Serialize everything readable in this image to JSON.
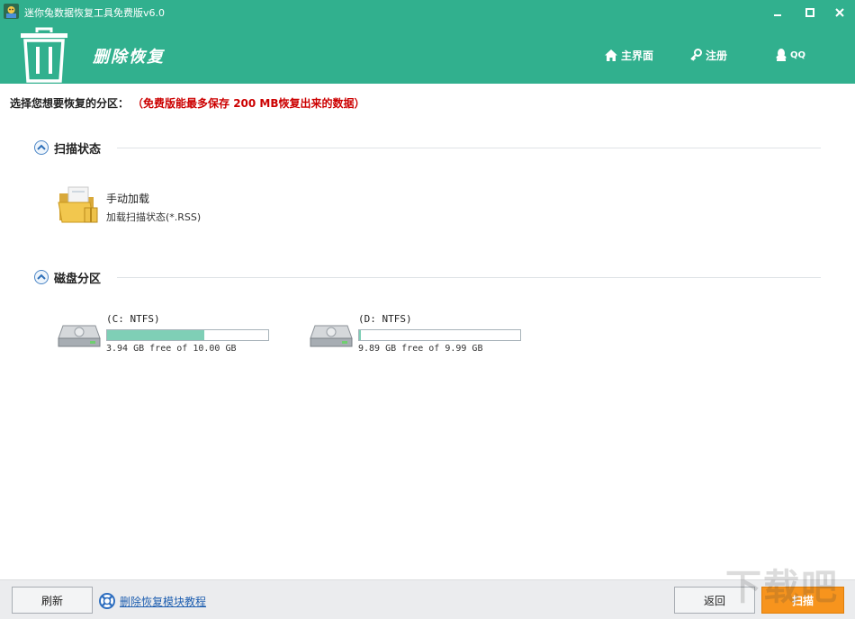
{
  "window": {
    "title": "迷你兔数据恢复工具免费版v6.0",
    "controls": [
      "minimize-icon",
      "maximize-icon",
      "close-icon"
    ]
  },
  "header": {
    "module_title": "删除恢复",
    "nav": {
      "home": "主界面",
      "register": "注册",
      "qq": "QQ"
    },
    "background_color": "#31b08e"
  },
  "prompt": {
    "label": "选择您想要恢复的分区：",
    "note": "（免费版能最多保存 200 MB恢复出来的数据）",
    "note_color": "#cc0000"
  },
  "scan_status": {
    "title": "扫描状态",
    "load": {
      "title": "手动加载",
      "subtitle": "加载扫描状态(*.RSS)"
    }
  },
  "partitions": {
    "title": "磁盘分区",
    "drives": [
      {
        "name": "(C: NTFS)",
        "free_text": "3.94 GB free of 10.00 GB",
        "used_fraction": 0.606
      },
      {
        "name": "(D: NTFS)",
        "free_text": "9.89 GB free of 9.99 GB",
        "used_fraction": 0.01
      }
    ]
  },
  "footer": {
    "refresh": "刷新",
    "help_link": "删除恢复模块教程",
    "back": "返回",
    "scan": "扫描",
    "scan_color": "#f7941d"
  },
  "watermark": "下载吧"
}
